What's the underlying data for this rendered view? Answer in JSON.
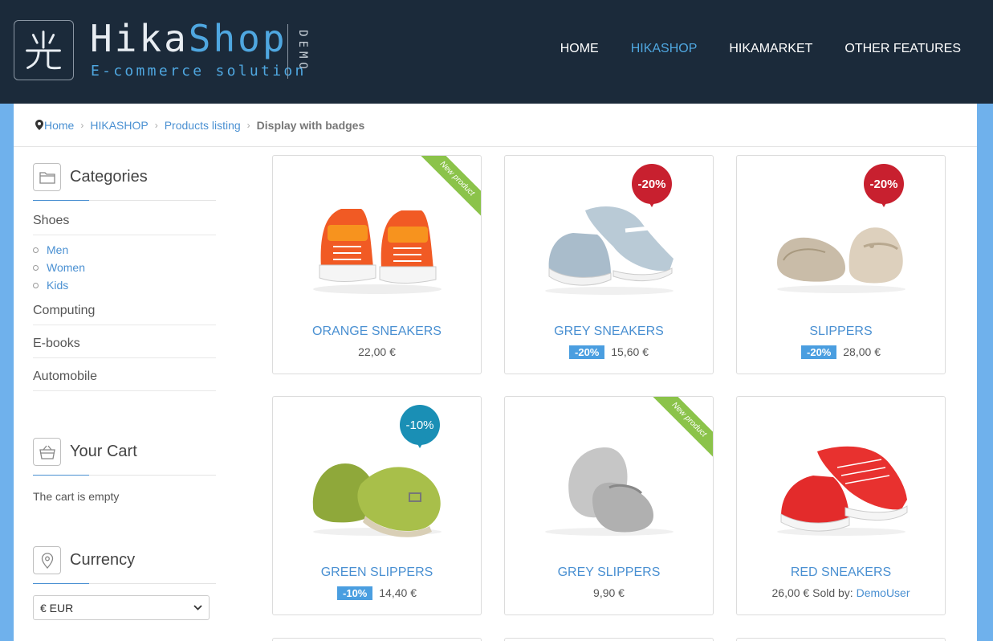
{
  "header": {
    "logo_word_1": "Hika",
    "logo_word_2": "Shop",
    "logo_subtitle": "E-commerce solution",
    "logo_demo": "DEMO",
    "nav": [
      {
        "label": "HOME",
        "active": false
      },
      {
        "label": "HIKASHOP",
        "active": true
      },
      {
        "label": "HIKAMARKET",
        "active": false
      },
      {
        "label": "OTHER FEATURES",
        "active": false
      }
    ]
  },
  "breadcrumb": {
    "items": [
      "Home",
      "HIKASHOP",
      "Products listing"
    ],
    "current": "Display with badges"
  },
  "sidebar": {
    "categories": {
      "title": "Categories",
      "items": [
        "Shoes",
        "Computing",
        "E-books",
        "Automobile"
      ],
      "shoes_subitems": [
        "Men",
        "Women",
        "Kids"
      ]
    },
    "cart": {
      "title": "Your Cart",
      "empty_text": "The cart is empty"
    },
    "currency": {
      "title": "Currency",
      "selected": "€ EUR"
    }
  },
  "products": [
    {
      "name": "ORANGE SNEAKERS",
      "discount": "",
      "price": "22,00 €",
      "badge": "New product",
      "badge_type": "ribbon"
    },
    {
      "name": "GREY SNEAKERS",
      "discount": "-20%",
      "price": "15,60 €",
      "badge": "-20%",
      "badge_type": "red-pin"
    },
    {
      "name": "SLIPPERS",
      "discount": "-20%",
      "price": "28,00 €",
      "badge": "-20%",
      "badge_type": "red-pin"
    },
    {
      "name": "GREEN SLIPPERS",
      "discount": "-10%",
      "price": "14,40 €",
      "badge": "-10%",
      "badge_type": "teal-pin"
    },
    {
      "name": "GREY SLIPPERS",
      "discount": "",
      "price": "9,90 €",
      "badge": "New product",
      "badge_type": "ribbon"
    },
    {
      "name": "RED SNEAKERS",
      "discount": "",
      "price": "26,00 €",
      "sold_by_label": "Sold by:",
      "seller": "DemoUser"
    }
  ],
  "colors": {
    "header_bg": "#1b2a3a",
    "page_bg": "#6fb1ec",
    "accent": "#4a90d2",
    "discount_label": "#4a9ee0",
    "ribbon": "#8bc34a",
    "red_pin": "#c8202f",
    "teal_pin": "#1a8fb5"
  }
}
